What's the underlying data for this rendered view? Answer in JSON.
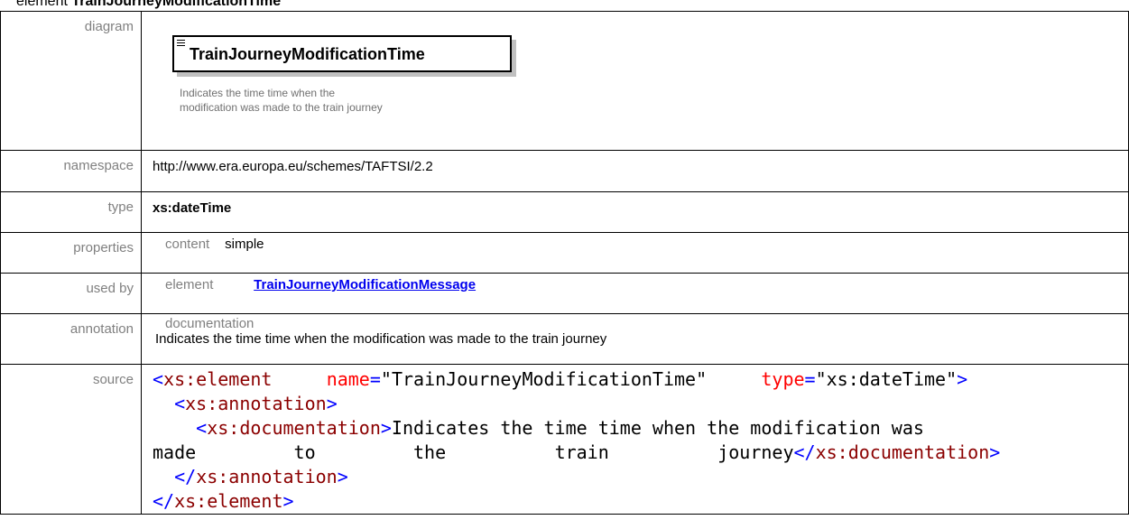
{
  "heading": {
    "prefix": "element",
    "name": "TrainJourneyModificationTime"
  },
  "diagram": {
    "label": "diagram",
    "element_name": "TrainJourneyModificationTime",
    "doc_line1": "Indicates the time time when the",
    "doc_line2": "modification was made to the train journey"
  },
  "namespace": {
    "label": "namespace",
    "value": "http://www.era.europa.eu/schemes/TAFTSI/2.2"
  },
  "type": {
    "label": "type",
    "value": "xs:dateTime"
  },
  "properties": {
    "label": "properties",
    "key": "content",
    "value": "simple"
  },
  "used_by": {
    "label": "used by",
    "key": "element",
    "link": "TrainJourneyModificationMessage"
  },
  "annotation": {
    "label": "annotation",
    "key": "documentation",
    "value": "Indicates the time time when the modification was made to the train journey"
  },
  "source": {
    "label": "source",
    "line1": {
      "open": "<",
      "tag": "xs:element",
      "attr1": "name",
      "eq1": "=",
      "val1": "\"TrainJourneyModificationTime\"",
      "attr2": "type",
      "eq2": "=",
      "val2": "\"xs:dateTime\"",
      "close": ">"
    },
    "line2": {
      "open": "<",
      "tag": "xs:annotation",
      "close": ">"
    },
    "line3": {
      "open": "<",
      "tag": "xs:documentation",
      "close": ">",
      "text": "Indicates the time time when the modification was"
    },
    "line4": {
      "w1": "made",
      "w2": "to",
      "w3": "the",
      "w4": "train",
      "w5": "journey",
      "endopen": "</",
      "endtag": "xs:documentation",
      "endclose": ">"
    },
    "line5": {
      "open": "</",
      "tag": "xs:annotation",
      "close": ">"
    },
    "line6": {
      "open": "</",
      "tag": "xs:element",
      "close": ">"
    }
  }
}
